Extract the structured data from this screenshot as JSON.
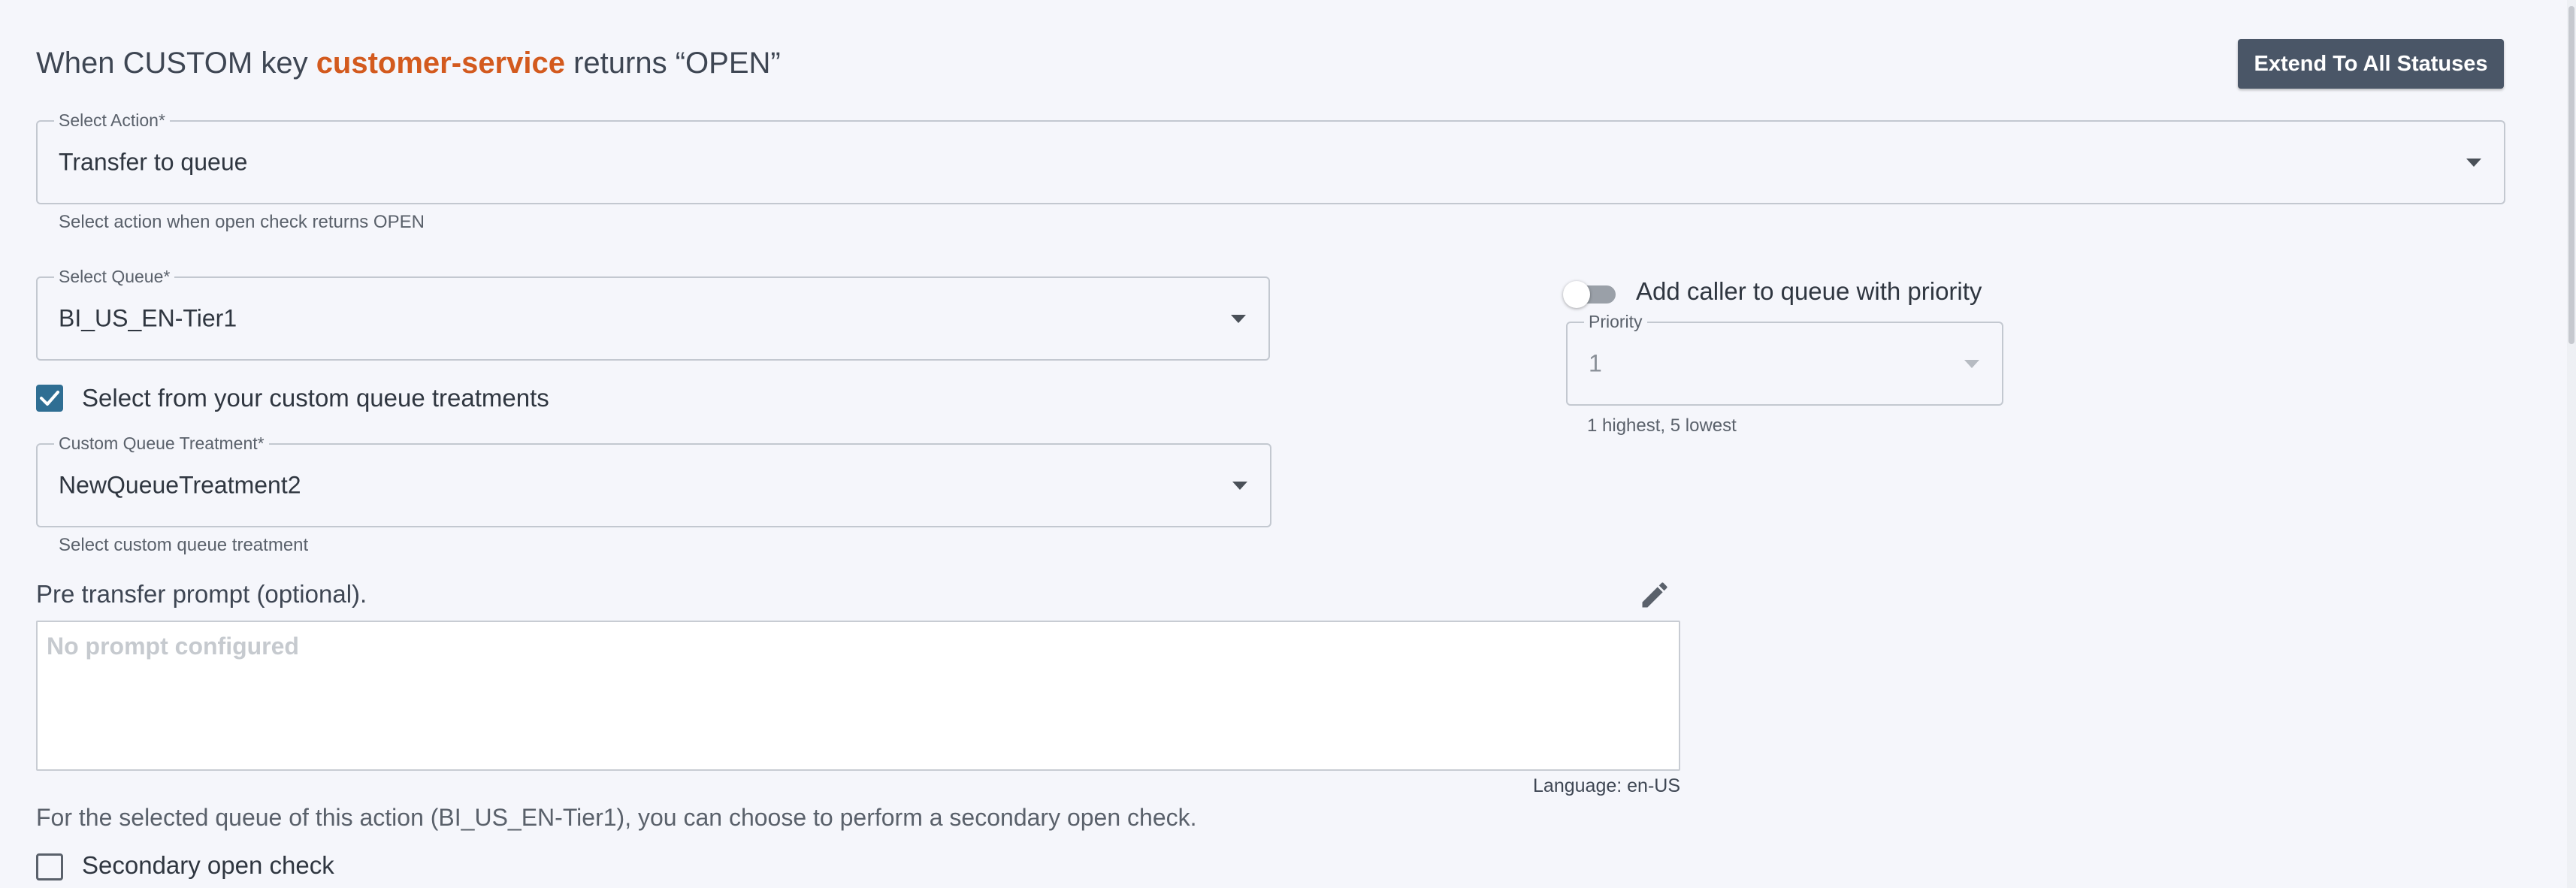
{
  "header": {
    "title_prefix": "When CUSTOM key ",
    "key_name": "customer-service",
    "title_suffix": " returns “OPEN”",
    "extend_button_label": "Extend To All Statuses"
  },
  "action": {
    "label": "Select Action*",
    "value": "Transfer to queue",
    "helper": "Select action when open check returns OPEN"
  },
  "queue": {
    "label": "Select Queue*",
    "value": "BI_US_EN-Tier1"
  },
  "priority_toggle": {
    "label": "Add caller to queue with priority",
    "enabled": false
  },
  "priority": {
    "label": "Priority",
    "value": "1",
    "helper": "1 highest, 5 lowest"
  },
  "custom_treatment_checkbox": {
    "label": "Select from your custom queue treatments",
    "checked": true
  },
  "treatment": {
    "label": "Custom Queue Treatment*",
    "value": "NewQueueTreatment2",
    "helper": "Select custom queue treatment"
  },
  "prompt": {
    "label": "Pre transfer prompt (optional).",
    "placeholder": "No prompt configured",
    "language": "Language: en-US"
  },
  "secondary": {
    "info": "For the selected queue of this action (BI_US_EN-Tier1), you can choose to perform a secondary open check.",
    "checkbox_label": "Secondary open check",
    "checked": false
  },
  "colors": {
    "accent": "#d35a1e",
    "button": "#4a5667",
    "checkbox": "#2f6e93",
    "background": "#f5f6fb"
  },
  "icons": {
    "edit": "pencil-icon",
    "dropdown": "chevron-down-icon",
    "check": "checkmark-icon"
  }
}
